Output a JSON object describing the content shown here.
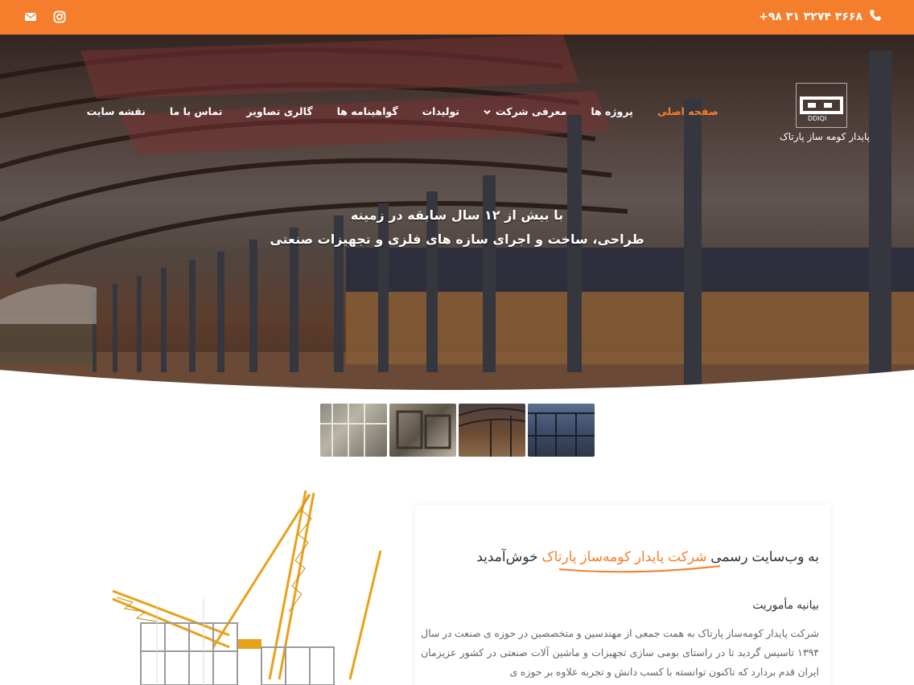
{
  "topbar": {
    "phone": "+۹۸ ۳۱ ۳۲۷۴ ۳۶۶۸",
    "phone_icon": "phone-icon",
    "social": [
      "envelope-icon",
      "instagram-icon"
    ],
    "accent_color": "#f47e2b"
  },
  "logo": {
    "name": "پایدار کومه ساز پارتاک"
  },
  "nav": {
    "items": [
      {
        "label": "صفحه اصلی",
        "active": true
      },
      {
        "label": "پروژه ها"
      },
      {
        "label": "معرفی شرکت",
        "has_dropdown": true
      },
      {
        "label": "تولیدات"
      },
      {
        "label": "گواهینامه ها"
      },
      {
        "label": "گالری تصاویر"
      },
      {
        "label": "تماس با ما"
      },
      {
        "label": "نقشه سایت"
      }
    ]
  },
  "hero": {
    "line1": "با بیش از ۱۲ سال سابقه در زمینه",
    "line2": "طراحی، ساخت و اجرای سازه های فلزی و تجهیزات صنعتی"
  },
  "content": {
    "welcome_prefix": "به وب‌سایت رسمی",
    "welcome_highlight": "شرکت پایدار کومه‌ساز پارتاک",
    "welcome_suffix": "خوش‌آمدید",
    "mission_title": "بیانیه مأموریت",
    "paragraph": "شرکت پایدار کومه‌ساز پارتاک به همت جمعی از مهندسین و متخصصین در حوزه ی صنعت در سال ۱۳۹۴ تاسیس گردید تا در راستای بومی سازی تجهیزات و ماشین آلات صنعتی در کشور عزیزمان ایران قدم بردارد که تاکنون توانسته با کسب دانش و تجربه علاوه بر حوزه ی"
  }
}
